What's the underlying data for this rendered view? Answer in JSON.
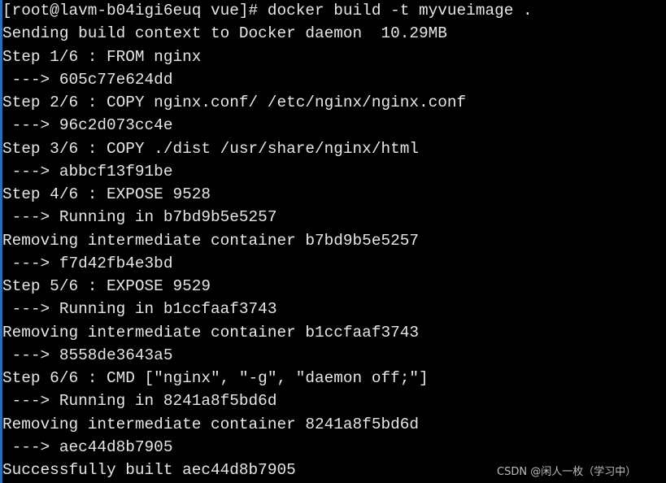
{
  "terminal": {
    "lines": [
      "[root@lavm-b04igi6euq vue]# docker build -t myvueimage .",
      "Sending build context to Docker daemon  10.29MB",
      "Step 1/6 : FROM nginx",
      " ---> 605c77e624dd",
      "Step 2/6 : COPY nginx.conf/ /etc/nginx/nginx.conf",
      " ---> 96c2d073cc4e",
      "Step 3/6 : COPY ./dist /usr/share/nginx/html",
      " ---> abbcf13f91be",
      "Step 4/6 : EXPOSE 9528",
      " ---> Running in b7bd9b5e5257",
      "Removing intermediate container b7bd9b5e5257",
      " ---> f7d42fb4e3bd",
      "Step 5/6 : EXPOSE 9529",
      " ---> Running in b1ccfaaf3743",
      "Removing intermediate container b1ccfaaf3743",
      " ---> 8558de3643a5",
      "Step 6/6 : CMD [\"nginx\", \"-g\", \"daemon off;\"]",
      " ---> Running in 8241a8f5bd6d",
      "Removing intermediate container 8241a8f5bd6d",
      " ---> aec44d8b7905",
      "Successfully built aec44d8b7905"
    ]
  },
  "watermark": "CSDN @闲人一枚（学习中）",
  "colors": {
    "background": "#000000",
    "text": "#e6e6e6",
    "edge": "#1e6fd0"
  }
}
